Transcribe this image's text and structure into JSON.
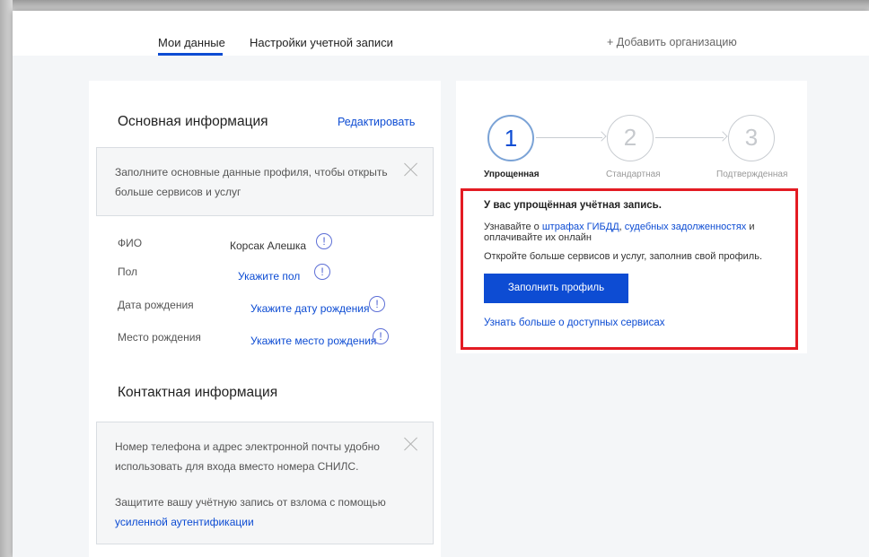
{
  "tabs": {
    "my_data": "Мои данные",
    "account_settings": "Настройки учетной записи",
    "add_org": "+ Добавить организацию"
  },
  "basic_info": {
    "title": "Основная информация",
    "edit": "Редактировать",
    "notice": "Заполните основные данные профиля, чтобы открыть больше сервисов и услуг",
    "fields": [
      {
        "label": "ФИО",
        "value": "Корсак Алешка"
      },
      {
        "label": "Пол",
        "value": "Укажите пол"
      },
      {
        "label": "Дата рождения",
        "value": "Укажите дату рождения"
      },
      {
        "label": "Место рождения",
        "value": "Укажите место рождения"
      }
    ],
    "warn_glyph": "!"
  },
  "contact_info": {
    "title": "Контактная информация",
    "notice_1": "Номер телефона и адрес электронной почты удобно использовать для входа вместо номера СНИЛС.",
    "notice_2_prefix": "Защитите вашу учётную запись от взлома с помощью",
    "notice_2_link": "усиленной аутентификации"
  },
  "steps": [
    {
      "number": "1",
      "label": "Упрощенная",
      "active": true
    },
    {
      "number": "2",
      "label": "Стандартная",
      "active": false
    },
    {
      "number": "3",
      "label": "Подтвержденная",
      "active": false
    }
  ],
  "account_info": {
    "title": "У вас упрощённая учётная запись.",
    "text_prefix": "Узнавайте о",
    "link_fines": "штрафах ГИБДД",
    "sep": ",",
    "link_debts": "судебных задолженностях",
    "text_suffix": "и оплачивайте их онлайн",
    "text_2": "Откройте больше сервисов и услуг, заполнив свой профиль.",
    "button": "Заполнить профиль",
    "more_link": "Узнать больше о доступных сервисах"
  },
  "colors": {
    "accent": "#0d4cd3",
    "highlight_border": "#e31b23",
    "background": "#f4f6f8"
  }
}
